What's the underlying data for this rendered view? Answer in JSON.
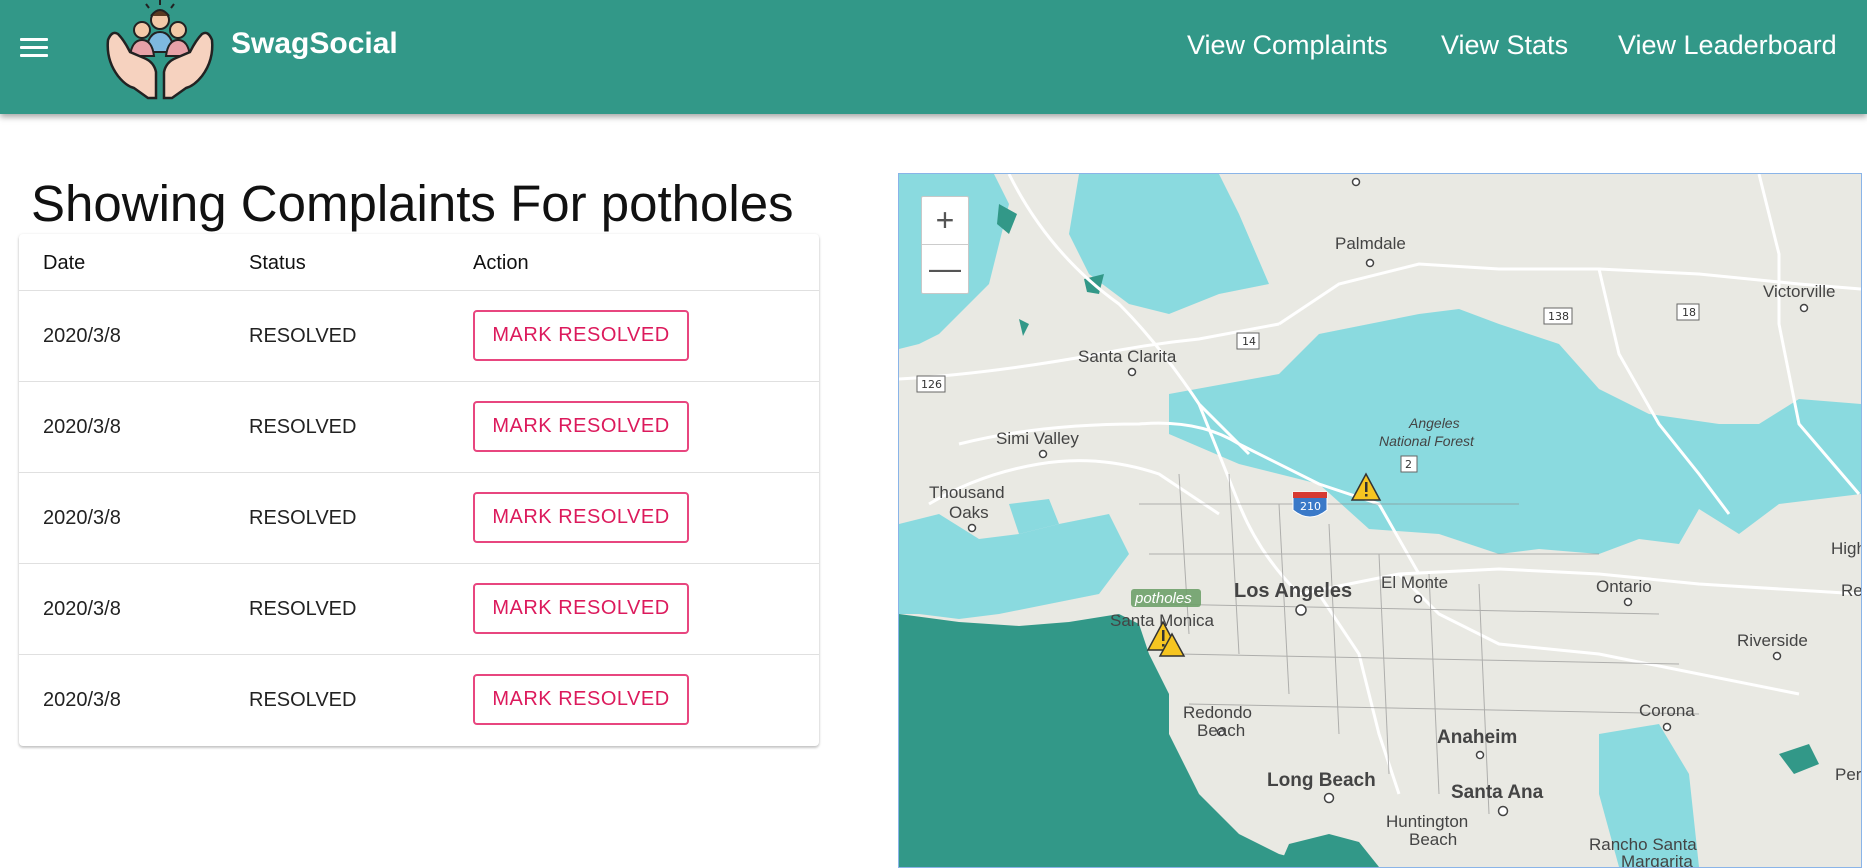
{
  "header": {
    "brand": "SwagSocial",
    "nav": [
      "View Complaints",
      "View Stats",
      "View Leaderboard"
    ]
  },
  "page_title": "Showing Complaints For potholes",
  "table": {
    "columns": [
      "Date",
      "Status",
      "Action"
    ],
    "rows": [
      {
        "date": "2020/3/8",
        "status": "RESOLVED",
        "action": "MARK RESOLVED"
      },
      {
        "date": "2020/3/8",
        "status": "RESOLVED",
        "action": "MARK RESOLVED"
      },
      {
        "date": "2020/3/8",
        "status": "RESOLVED",
        "action": "MARK RESOLVED"
      },
      {
        "date": "2020/3/8",
        "status": "RESOLVED",
        "action": "MARK RESOLVED"
      },
      {
        "date": "2020/3/8",
        "status": "RESOLVED",
        "action": "MARK RESOLVED"
      }
    ]
  },
  "map": {
    "zoom_in": "+",
    "zoom_out": "—",
    "marker_label": "potholes",
    "labels": {
      "palmdale": "Palmdale",
      "victorville": "Victorville",
      "santa_clarita": "Santa Clarita",
      "simi_valley": "Simi Valley",
      "thousand_oaks_1": "Thousand",
      "thousand_oaks_2": "Oaks",
      "angeles_nf_1": "Angeles",
      "angeles_nf_2": "National Forest",
      "los_angeles": "Los Angeles",
      "el_monte": "El Monte",
      "ontario": "Ontario",
      "santa_monica": "Santa Monica",
      "riverside": "Riverside",
      "redondo_1": "Redondo",
      "redondo_2": "Beach",
      "corona": "Corona",
      "anaheim": "Anaheim",
      "long_beach": "Long Beach",
      "santa_ana": "Santa Ana",
      "huntington_1": "Huntington",
      "huntington_2": "Beach",
      "rancho": "Rancho Santa",
      "rancho_2": "Margarita",
      "high": "High",
      "re": "Re",
      "per": "Per"
    },
    "route_shields": [
      "138",
      "18",
      "14",
      "126",
      "2",
      "210"
    ],
    "colors": {
      "land": "#e9e9e3",
      "water": "#329888",
      "forest": "#8adadf",
      "marker": "#f6c521",
      "header": "#329888"
    }
  }
}
